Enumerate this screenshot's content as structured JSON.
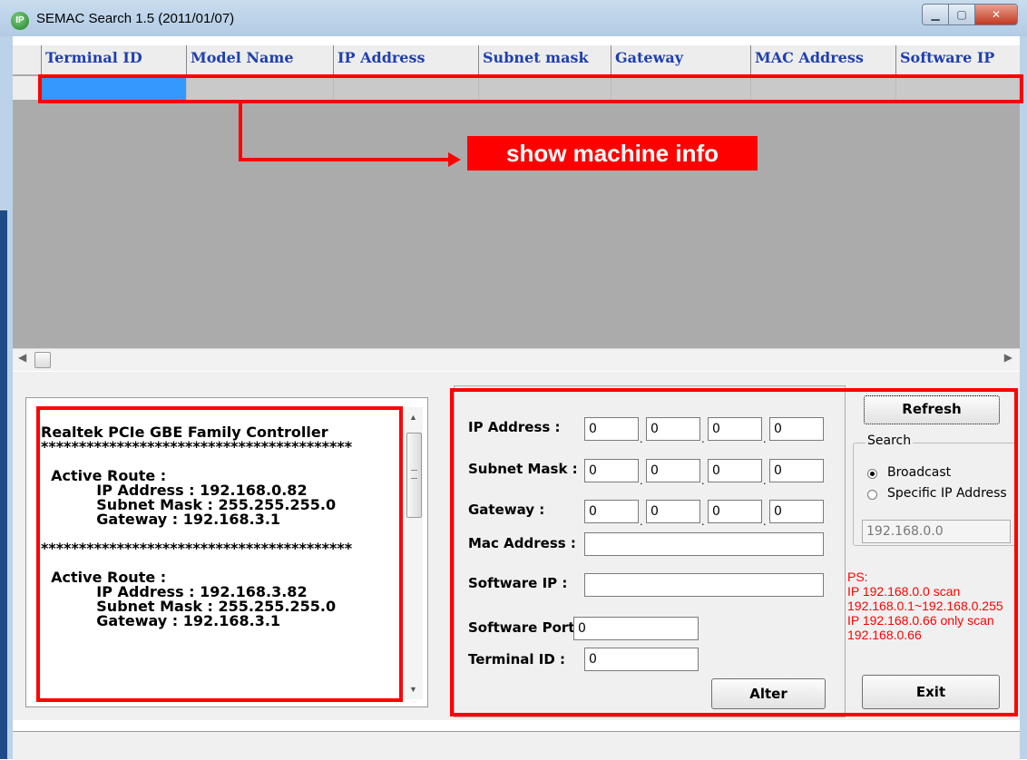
{
  "window": {
    "title": "SEMAC Search 1.5 (2011/01/07)",
    "app_icon": "IP"
  },
  "grid": {
    "columns": [
      "Terminal ID",
      "Model Name",
      "IP Address",
      "Subnet mask",
      "Gateway",
      "MAC Address",
      "Software IP"
    ]
  },
  "annotation": {
    "label": "show machine info"
  },
  "info": {
    "text": "Realtek PCIe GBE Family Controller\n*****************************************\n\n  Active Route :\n           IP Address : 192.168.0.82\n           Subnet Mask : 255.255.255.0\n           Gateway : 192.168.3.1\n\n*****************************************\n\n  Active Route :\n           IP Address : 192.168.3.82\n           Subnet Mask : 255.255.255.0\n           Gateway : 192.168.3.1"
  },
  "form": {
    "ip_label": "IP Address :",
    "subnet_label": "Subnet Mask :",
    "gateway_label": "Gateway :",
    "mac_label": "Mac Address :",
    "software_ip_label": "Software IP :",
    "software_port_label": "Software Port :",
    "terminal_id_label": "Terminal ID :",
    "ip": [
      "0",
      "0",
      "0",
      "0"
    ],
    "subnet": [
      "0",
      "0",
      "0",
      "0"
    ],
    "gateway": [
      "0",
      "0",
      "0",
      "0"
    ],
    "mac": "",
    "software_ip": "",
    "software_port": "0",
    "terminal_id": "0",
    "dot": ".",
    "alter_label": "Alter"
  },
  "side": {
    "refresh_label": "Refresh",
    "search_legend": "Search",
    "broadcast_label": "Broadcast",
    "specific_label": "Specific IP Address",
    "specific_ip": "192.168.0.0",
    "ps_note": "PS:\nIP 192.168.0.0 scan\n192.168.0.1~192.168.0.255\nIP 192.168.0.66 only scan\n192.168.0.66",
    "exit_label": "Exit"
  },
  "colors": {
    "annotation": "#ff0000",
    "selection": "#3399ff",
    "header_text": "#1f3fb0"
  }
}
